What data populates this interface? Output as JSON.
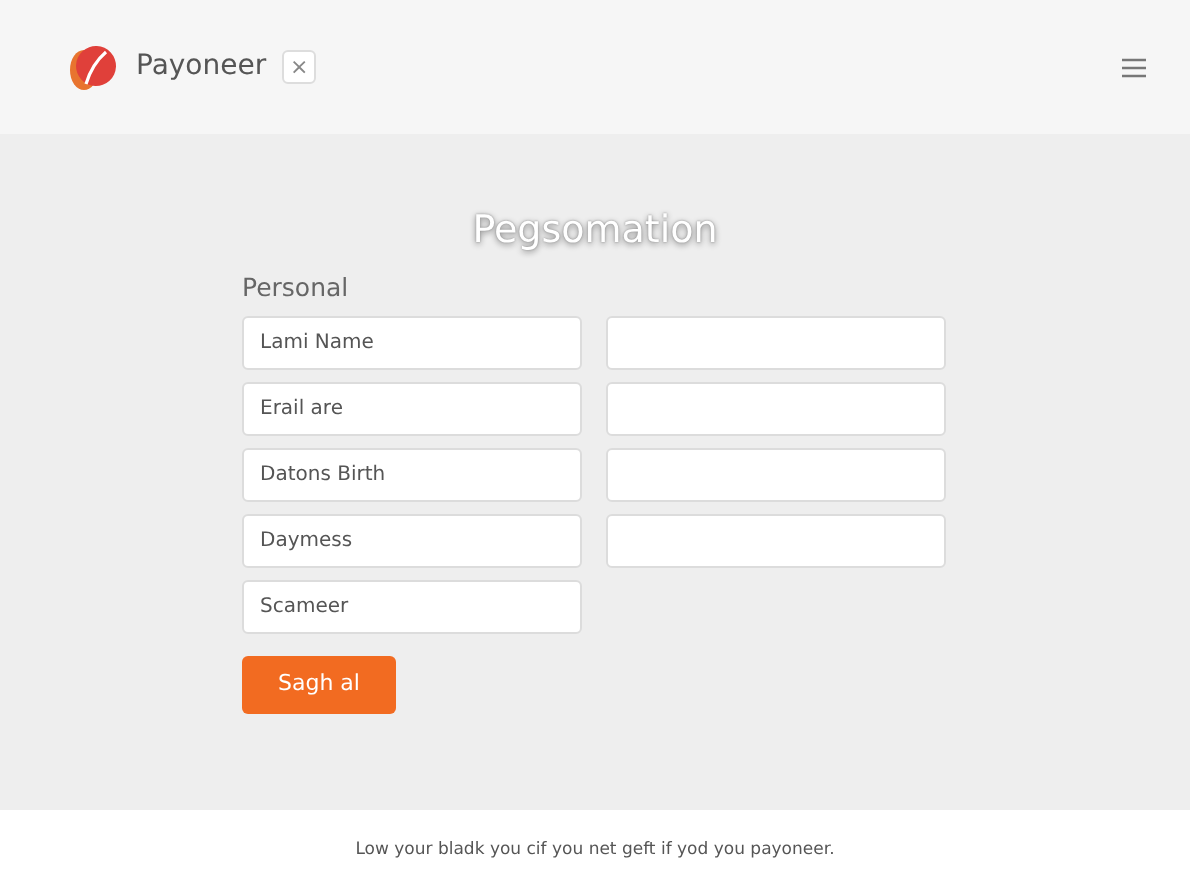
{
  "header": {
    "brand": "Payoneer",
    "close_glyph": "×"
  },
  "title": "Pegsomation",
  "section_label": "Personal",
  "rows": [
    {
      "left": {
        "kind": "input",
        "placeholder": "Lami Name"
      },
      "right": {
        "kind": "input"
      }
    },
    {
      "left": {
        "kind": "input",
        "placeholder": "Erail are"
      },
      "right": {
        "kind": "input"
      }
    },
    {
      "left": {
        "kind": "input",
        "placeholder": "Datons Birth"
      },
      "right": {
        "kind": "input"
      }
    },
    {
      "left": {
        "kind": "input",
        "placeholder": "Daymess"
      },
      "right": {
        "kind": "input"
      }
    },
    {
      "left": {
        "kind": "input",
        "placeholder": "Scameer"
      }
    }
  ],
  "submit_button": "Sagh al",
  "footer": "Low your bladk you cif you net geft if yod you payoneer."
}
